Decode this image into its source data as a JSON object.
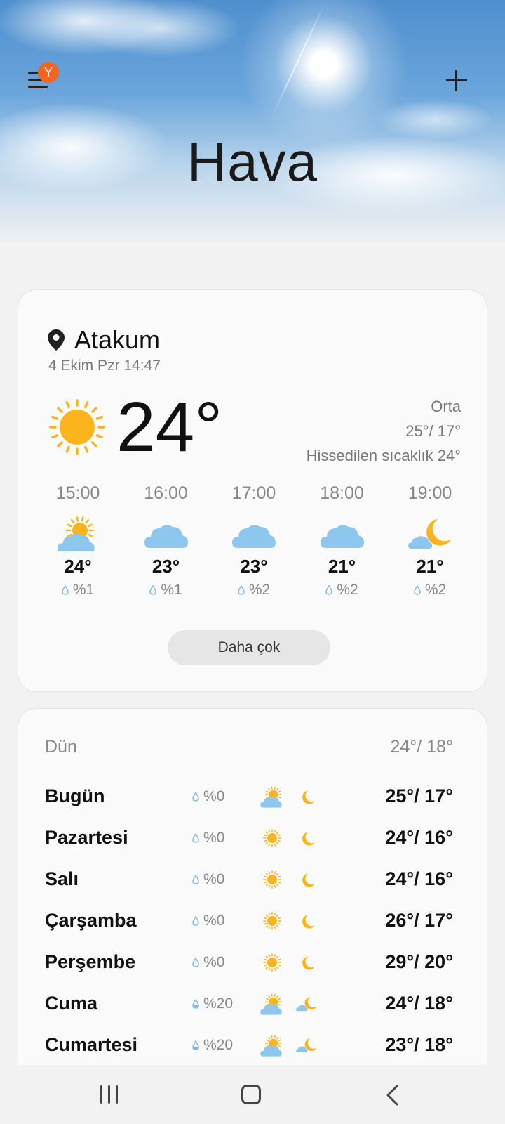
{
  "header": {
    "title": "Hava",
    "badge": "Y"
  },
  "current": {
    "location": "Atakum",
    "datetime": "4 Ekim Pzr 14:47",
    "temperature": "24°",
    "condition_icon": "sun-icon",
    "description": "Orta",
    "high_low": "25°/ 17°",
    "feels_like": "Hissedilen sıcaklık 24°"
  },
  "hourly": [
    {
      "time": "15:00",
      "icon": "partly-cloudy-icon",
      "temp": "24°",
      "rain": "%1"
    },
    {
      "time": "16:00",
      "icon": "cloud-icon",
      "temp": "23°",
      "rain": "%1"
    },
    {
      "time": "17:00",
      "icon": "cloud-icon",
      "temp": "23°",
      "rain": "%2"
    },
    {
      "time": "18:00",
      "icon": "cloud-icon",
      "temp": "21°",
      "rain": "%2"
    },
    {
      "time": "19:00",
      "icon": "moon-cloud-icon",
      "temp": "21°",
      "rain": "%2"
    }
  ],
  "more_button": "Daha çok",
  "daily": {
    "yesterday": {
      "label": "Dün",
      "range": "24°/ 18°"
    },
    "days": [
      {
        "name": "Bugün",
        "rain": "%0",
        "day_icon": "partly-cloudy-icon",
        "night_icon": "moon-icon",
        "range": "25°/ 17°"
      },
      {
        "name": "Pazartesi",
        "rain": "%0",
        "day_icon": "sun-icon",
        "night_icon": "moon-icon",
        "range": "24°/ 16°"
      },
      {
        "name": "Salı",
        "rain": "%0",
        "day_icon": "sun-icon",
        "night_icon": "moon-icon",
        "range": "24°/ 16°"
      },
      {
        "name": "Çarşamba",
        "rain": "%0",
        "day_icon": "sun-icon",
        "night_icon": "moon-icon",
        "range": "26°/ 17°"
      },
      {
        "name": "Perşembe",
        "rain": "%0",
        "day_icon": "sun-icon",
        "night_icon": "moon-icon",
        "range": "29°/ 20°"
      },
      {
        "name": "Cuma",
        "rain": "%20",
        "day_icon": "partly-cloudy-icon",
        "night_icon": "moon-cloud-icon",
        "range": "24°/ 18°"
      },
      {
        "name": "Cumartesi",
        "rain": "%20",
        "day_icon": "partly-cloudy-icon",
        "night_icon": "moon-cloud-icon",
        "range": "23°/ 18°"
      }
    ]
  },
  "colors": {
    "sun": "#fbb41e",
    "cloud": "#8ec6ee",
    "badge": "#f26522",
    "drop": "#7fb6e6"
  }
}
